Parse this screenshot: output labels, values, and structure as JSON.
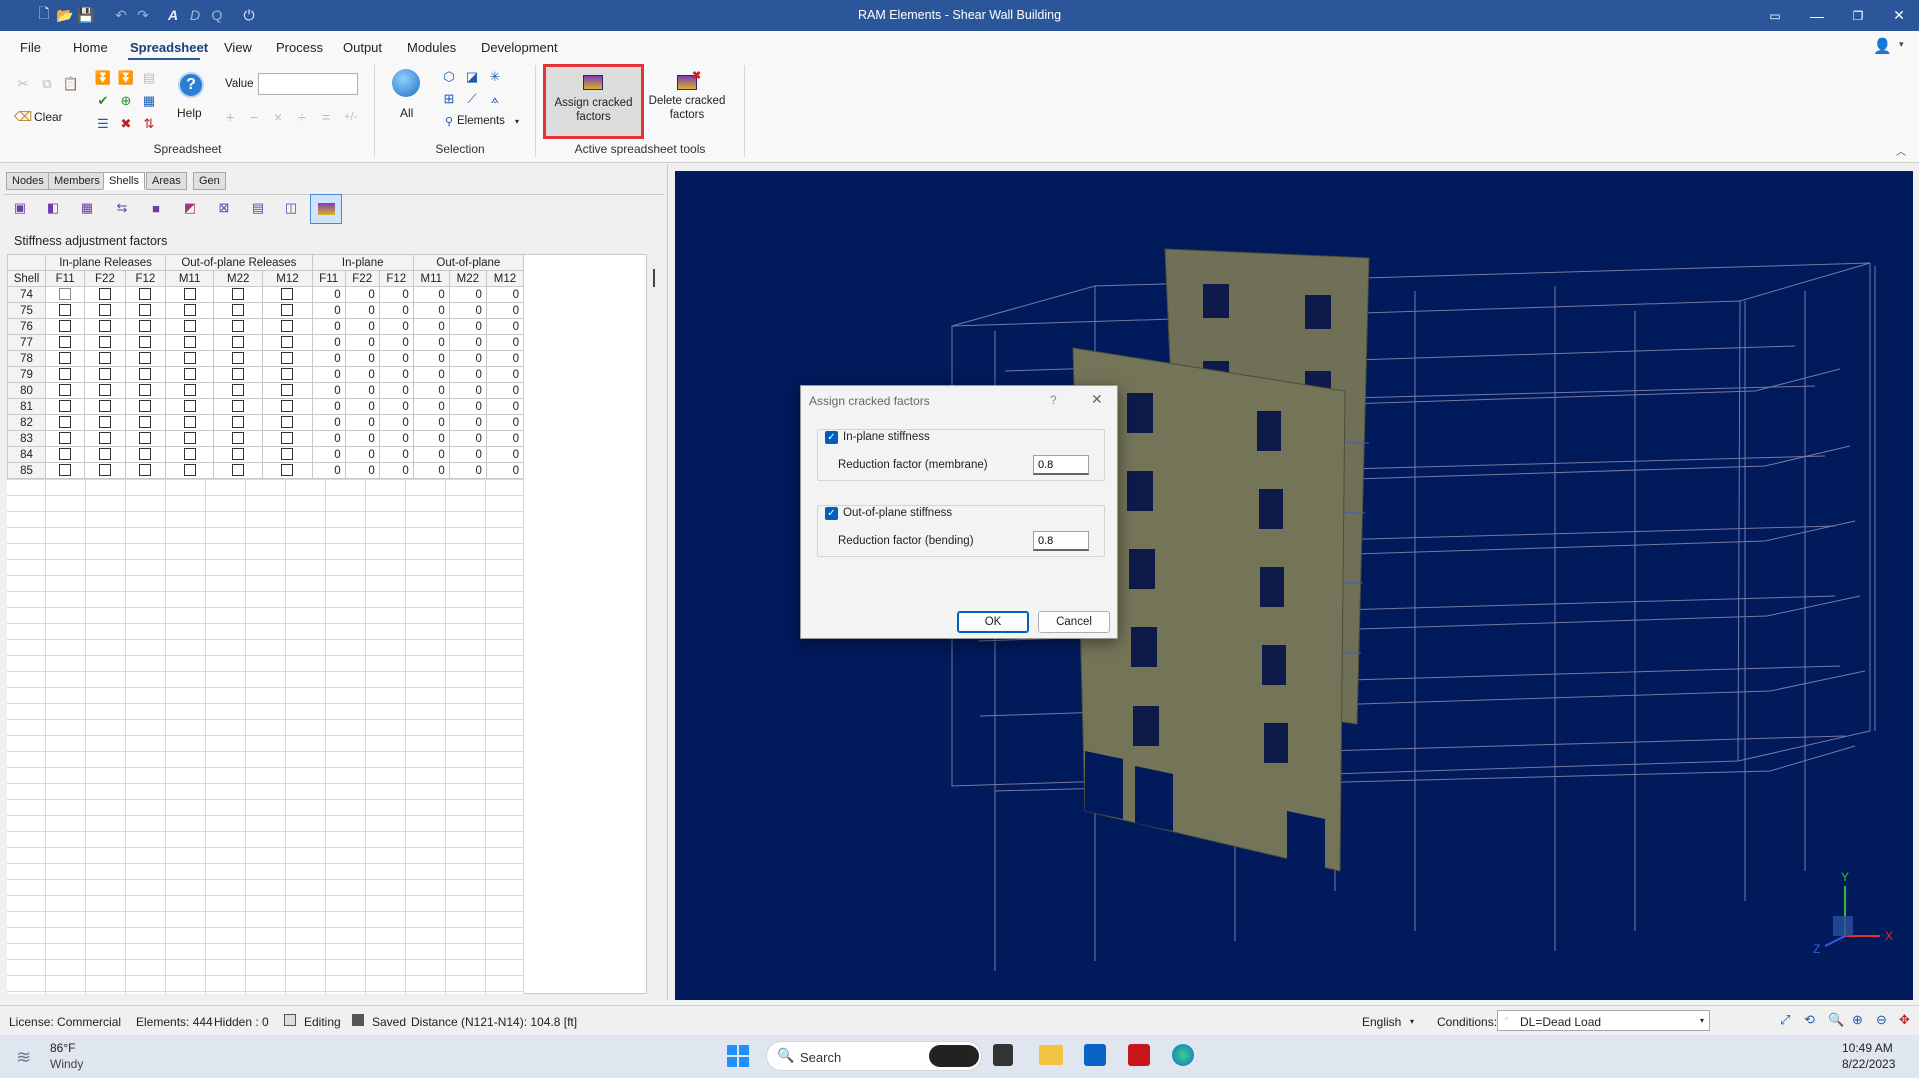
{
  "window": {
    "title": "RAM Elements - Shear Wall Building"
  },
  "menu": [
    "File",
    "Home",
    "Spreadsheet",
    "View",
    "Process",
    "Output",
    "Modules",
    "Development"
  ],
  "ribbon": {
    "clear_label": "Clear",
    "help_label": "Help",
    "value_label": "Value",
    "value_input": "",
    "all_label": "All",
    "elements_label": "Elements",
    "assign_label_1": "Assign cracked",
    "assign_label_2": "factors",
    "delete_label_1": "Delete cracked",
    "delete_label_2": "factors",
    "group_spreadsheet": "Spreadsheet",
    "group_selection": "Selection",
    "group_tools": "Active spreadsheet tools",
    "math_ops": [
      "+",
      "−",
      "×",
      "÷",
      "=",
      "+/-"
    ]
  },
  "tabs": [
    "Nodes",
    "Members",
    "Shells",
    "Areas",
    "Gen"
  ],
  "panel_title": "Stiffness adjustment factors",
  "table": {
    "group_headers": [
      "In-plane Releases",
      "Out-of-plane Releases",
      "In-plane",
      "Out-of-plane"
    ],
    "columns": [
      "Shell",
      "F11",
      "F22",
      "F12",
      "M11",
      "M22",
      "M12",
      "F11",
      "F22",
      "F12",
      "M11",
      "M22",
      "M12"
    ],
    "rows": [
      {
        "id": "74",
        "vals": [
          "0",
          "0",
          "0",
          "0",
          "0",
          "0"
        ]
      },
      {
        "id": "75",
        "vals": [
          "0",
          "0",
          "0",
          "0",
          "0",
          "0"
        ]
      },
      {
        "id": "76",
        "vals": [
          "0",
          "0",
          "0",
          "0",
          "0",
          "0"
        ]
      },
      {
        "id": "77",
        "vals": [
          "0",
          "0",
          "0",
          "0",
          "0",
          "0"
        ]
      },
      {
        "id": "78",
        "vals": [
          "0",
          "0",
          "0",
          "0",
          "0",
          "0"
        ]
      },
      {
        "id": "79",
        "vals": [
          "0",
          "0",
          "0",
          "0",
          "0",
          "0"
        ]
      },
      {
        "id": "80",
        "vals": [
          "0",
          "0",
          "0",
          "0",
          "0",
          "0"
        ]
      },
      {
        "id": "81",
        "vals": [
          "0",
          "0",
          "0",
          "0",
          "0",
          "0"
        ]
      },
      {
        "id": "82",
        "vals": [
          "0",
          "0",
          "0",
          "0",
          "0",
          "0"
        ]
      },
      {
        "id": "83",
        "vals": [
          "0",
          "0",
          "0",
          "0",
          "0",
          "0"
        ]
      },
      {
        "id": "84",
        "vals": [
          "0",
          "0",
          "0",
          "0",
          "0",
          "0"
        ]
      },
      {
        "id": "85",
        "vals": [
          "0",
          "0",
          "0",
          "0",
          "0",
          "0"
        ]
      }
    ]
  },
  "dialog": {
    "title": "Assign cracked factors",
    "help": "?",
    "inplane_label": "In-plane stiffness",
    "membrane_label": "Reduction factor (membrane)",
    "membrane_value": "0.8",
    "outplane_label": "Out-of-plane stiffness",
    "bending_label": "Reduction factor (bending)",
    "bending_value": "0.8",
    "ok": "OK",
    "cancel": "Cancel"
  },
  "status": {
    "license": "License: Commercial",
    "elements": "Elements: 444",
    "hidden": "Hidden : 0",
    "editing": "Editing",
    "saved": "Saved",
    "distance": "Distance (N121-N14): 104.8 [ft]",
    "language": "English",
    "conditions_label": "Conditions:",
    "conditions_value": "DL=Dead Load"
  },
  "taskbar": {
    "temp": "86°F",
    "weather": "Windy",
    "search": "Search",
    "time": "10:49 AM",
    "date": "8/22/2023"
  },
  "axes": {
    "y": "Y",
    "x": "X",
    "z": "Z"
  }
}
